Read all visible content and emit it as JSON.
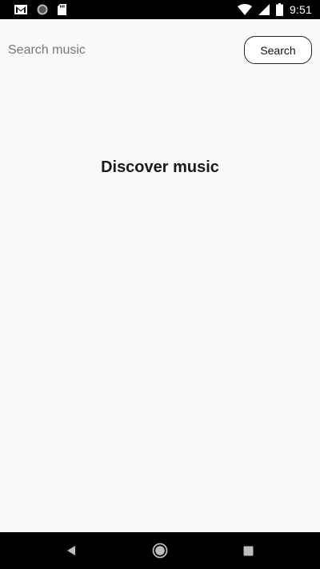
{
  "status_bar": {
    "time": "9:51",
    "left_icons": [
      "gmail-icon",
      "circle-app-icon",
      "sd-card-icon"
    ],
    "right_icons": [
      "wifi-icon",
      "cell-signal-icon",
      "battery-icon"
    ]
  },
  "search": {
    "placeholder": "Search music",
    "value": "",
    "button_label": "Search"
  },
  "main": {
    "heading": "Discover music"
  },
  "nav_bar": {
    "buttons": [
      "back-icon",
      "home-icon",
      "recents-icon"
    ]
  },
  "colors": {
    "background": "#fafafa",
    "bars": "#000000",
    "text": "#1a1a1a"
  }
}
